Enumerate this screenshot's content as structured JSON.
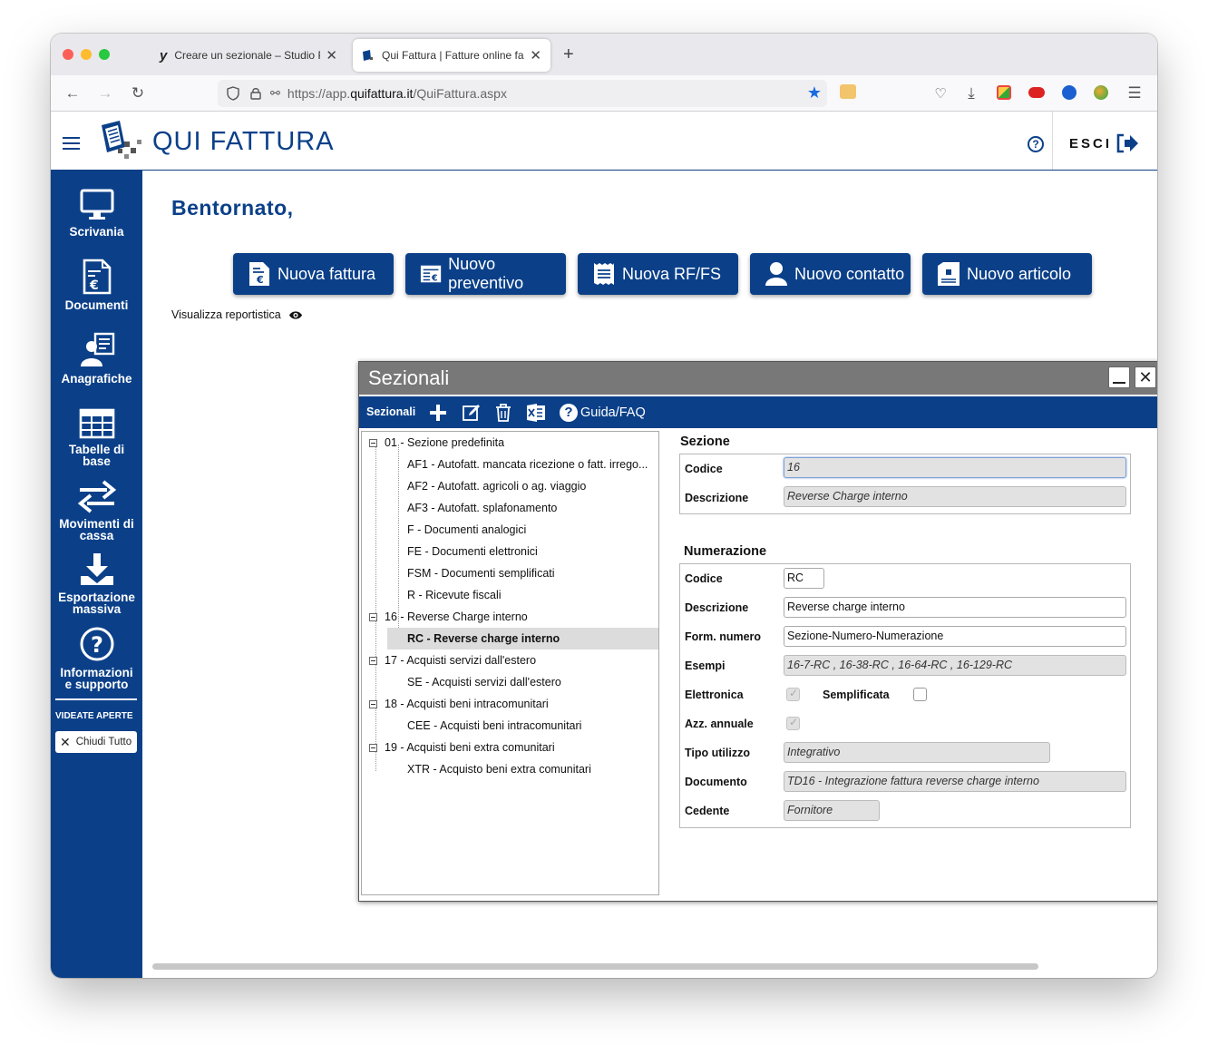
{
  "browser": {
    "tabs": [
      {
        "title": "Creare un sezionale – Studio Pir"
      },
      {
        "title": "Qui Fattura | Fatture online facili"
      }
    ],
    "url": {
      "protocol": "https://app.",
      "host": "quifattura.it",
      "path": "/QuiFattura.aspx"
    }
  },
  "header": {
    "brand": "QUI FATTURA",
    "logout_label": "ESCI"
  },
  "sidebar": {
    "items": [
      {
        "label": "Scrivania"
      },
      {
        "label": "Documenti"
      },
      {
        "label": "Anagrafiche"
      },
      {
        "label_line1": "Tabelle di",
        "label_line2": "base"
      },
      {
        "label_line1": "Movimenti di",
        "label_line2": "cassa"
      },
      {
        "label_line1": "Esportazione",
        "label_line2": "massiva"
      },
      {
        "label_line1": "Informazioni",
        "label_line2": "e supporto"
      }
    ],
    "open_views_label": "VIDEATE APERTE",
    "close_all_label": "Chiudi Tutto"
  },
  "main": {
    "welcome": "Bentornato,",
    "actions": [
      {
        "label": "Nuova fattura"
      },
      {
        "label": "Nuovo preventivo"
      },
      {
        "label": "Nuova RF/FS"
      },
      {
        "label": "Nuovo contatto"
      },
      {
        "label": "Nuovo articolo"
      }
    ],
    "reports_link": "Visualizza reportistica"
  },
  "modal": {
    "title": "Sezionali",
    "toolbar": {
      "label": "Sezionali",
      "help_label": "Guida/FAQ"
    },
    "tree": [
      {
        "label": "01 - Sezione predefinita"
      },
      {
        "label": "AF1 - Autofatt. mancata ricezione o fatt. irrego..."
      },
      {
        "label": "AF2 - Autofatt. agricoli o ag. viaggio"
      },
      {
        "label": "AF3 - Autofatt. splafonamento"
      },
      {
        "label": "F - Documenti analogici"
      },
      {
        "label": "FE - Documenti elettronici"
      },
      {
        "label": "FSM - Documenti semplificati"
      },
      {
        "label": "R - Ricevute fiscali"
      },
      {
        "label": "16 - Reverse Charge interno"
      },
      {
        "label": "RC - Reverse charge interno"
      },
      {
        "label": "17 - Acquisti servizi dall'estero"
      },
      {
        "label": "SE - Acquisti servizi dall'estero"
      },
      {
        "label": "18 - Acquisti beni intracomunitari"
      },
      {
        "label": "CEE - Acquisti beni intracomunitari"
      },
      {
        "label": "19 - Acquisti beni extra comunitari"
      },
      {
        "label": "XTR - Acquisto beni extra comunitari"
      }
    ],
    "sezione": {
      "heading": "Sezione",
      "codice_label": "Codice",
      "codice_value": "16",
      "descrizione_label": "Descrizione",
      "descrizione_value": "Reverse Charge interno"
    },
    "numerazione": {
      "heading": "Numerazione",
      "codice_label": "Codice",
      "codice_value": "RC",
      "descrizione_label": "Descrizione",
      "descrizione_value": "Reverse charge interno",
      "form_numero_label": "Form. numero",
      "form_numero_value": "Sezione-Numero-Numerazione",
      "esempi_label": "Esempi",
      "esempi_value": "16-7-RC , 16-38-RC , 16-64-RC , 16-129-RC",
      "elettronica_label": "Elettronica",
      "elettronica_checked": true,
      "semplificata_label": "Semplificata",
      "semplificata_checked": false,
      "azz_annuale_label": "Azz. annuale",
      "azz_annuale_checked": true,
      "tipo_utilizzo_label": "Tipo utilizzo",
      "tipo_utilizzo_value": "Integrativo",
      "documento_label": "Documento",
      "documento_value": "TD16 - Integrazione fattura reverse charge interno",
      "cedente_label": "Cedente",
      "cedente_value": "Fornitore"
    }
  },
  "colors": {
    "brand_blue": "#0b4089",
    "modal_title_gray": "#787878"
  }
}
